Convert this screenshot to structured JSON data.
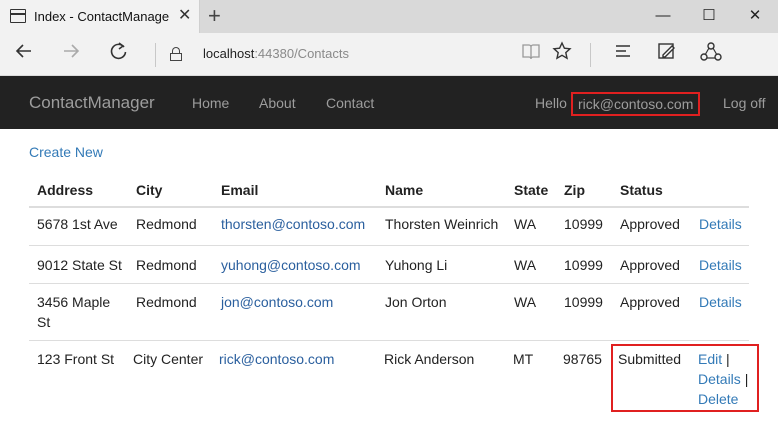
{
  "browser": {
    "tab_title": "Index - ContactManage",
    "tab_close": "✕",
    "new_tab": "+",
    "minimize": "—",
    "maximize": "☐",
    "close": "✕",
    "url_host": "localhost",
    "url_path": ":44380/Contacts",
    "icons": [
      "back-icon",
      "forward-icon",
      "refresh-icon",
      "lock-icon",
      "reading-view-icon",
      "favorite-star-icon",
      "hub-icon",
      "web-note-icon",
      "share-icon"
    ]
  },
  "navbar": {
    "brand": "ContactManager",
    "links": [
      "Home",
      "About",
      "Contact"
    ],
    "hello": "Hello",
    "user_email": "rick@contoso.com",
    "logoff": "Log off"
  },
  "content": {
    "create_new": "Create New",
    "columns": [
      "Address",
      "City",
      "Email",
      "Name",
      "State",
      "Zip",
      "Status"
    ],
    "rows": [
      {
        "address": "5678 1st Ave",
        "city": "Redmond",
        "email": "thorsten@contoso.com",
        "name": "Thorsten Weinrich",
        "state": "WA",
        "zip": "10999",
        "status": "Approved",
        "actions": [
          "Details"
        ]
      },
      {
        "address": "9012 State St",
        "city": "Redmond",
        "email": "yuhong@contoso.com",
        "name": "Yuhong Li",
        "state": "WA",
        "zip": "10999",
        "status": "Approved",
        "actions": [
          "Details"
        ]
      },
      {
        "address_line1": "3456 Maple",
        "address_line2": "St",
        "city": "Redmond",
        "email": "jon@contoso.com",
        "name": "Jon Orton",
        "state": "WA",
        "zip": "10999",
        "status": "Approved",
        "actions": [
          "Details"
        ]
      },
      {
        "address": "123 Front St",
        "city": "City Center",
        "email": "rick@contoso.com",
        "name": "Rick Anderson",
        "state": "MT",
        "zip": "98765",
        "status": "Submitted",
        "actions": [
          "Edit",
          "Details",
          "Delete"
        ],
        "separator": "|"
      }
    ]
  },
  "colors": {
    "navbar_bg": "#222222",
    "link": "#337ab7",
    "highlight": "#e02020"
  }
}
